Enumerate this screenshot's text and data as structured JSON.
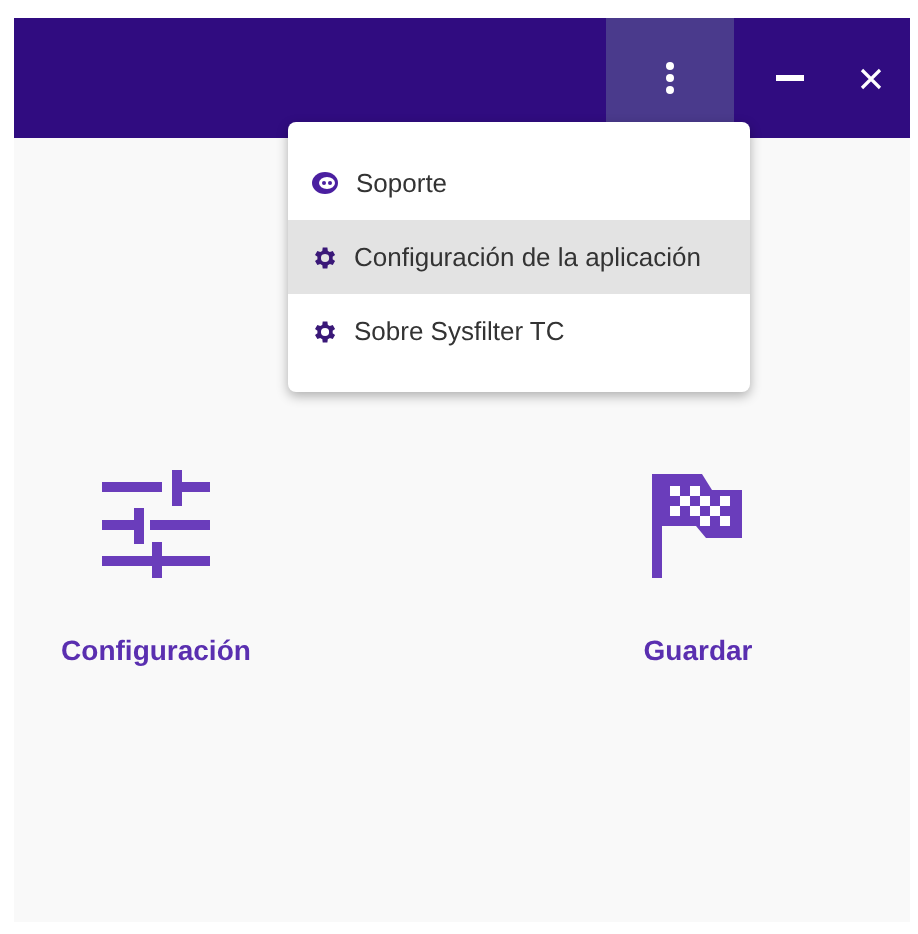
{
  "title_bar": {
    "menu_button": {
      "selected": true
    }
  },
  "menu": {
    "items": [
      {
        "kind": "support",
        "label": "Soporte",
        "selected": false
      },
      {
        "kind": "settings",
        "label": "Configuración de la aplicación",
        "selected": true
      },
      {
        "kind": "settings",
        "label": "Sobre Sysfilter TC",
        "selected": false
      }
    ]
  },
  "tiles": [
    {
      "kind": "sliders",
      "label": "Configuración"
    },
    {
      "kind": "flag",
      "label": "Guardar"
    }
  ]
}
